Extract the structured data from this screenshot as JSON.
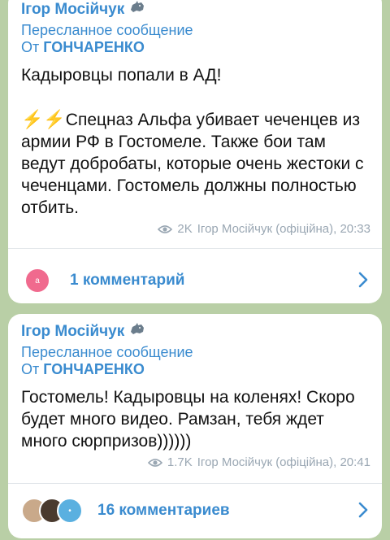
{
  "colors": {
    "accent": "#3a8bcf",
    "background": "#b9cfa6",
    "bubble": "#ffffff",
    "bolt": "#f2c200",
    "meta": "#9aa7b3"
  },
  "posts": [
    {
      "author": "Ігор Мосійчук",
      "author_icon": "rhino-emoji",
      "forward_label": "Пересланное сообщение",
      "forward_prefix": "От",
      "forward_from": "ГОНЧАРЕНКО",
      "paragraph1": "Кадыровцы попали в АД!",
      "bolts": "⚡⚡",
      "paragraph2": "Спецназ Альфа убивает чеченцев из армии РФ в Гостомеле. Также бои там ведут добробаты, которые очень жестоки с чеченцами. Гостомель должны полностью отбить.",
      "views": "2K",
      "signature": "Ігор Мосійчук (офіційна), 20:33",
      "comments_label": "1 комментарий",
      "comment_avatars": [
        "pink-avatar"
      ]
    },
    {
      "author": "Ігор Мосійчук",
      "author_icon": "rhino-emoji",
      "forward_label": "Пересланное сообщение",
      "forward_prefix": "От",
      "forward_from": "ГОНЧАРЕНКО",
      "paragraph1": "Гостомель! Кадыровцы на коленях! Скоро будет много видео. Рамзан, тебя ждет много сюрпризов))))))",
      "views": "1.7K",
      "signature": "Ігор Мосійчук (офіційна), 20:41",
      "comments_label": "16 комментариев",
      "comment_avatars": [
        "photo-avatar",
        "cartoon-avatar",
        "blue-avatar"
      ]
    }
  ]
}
